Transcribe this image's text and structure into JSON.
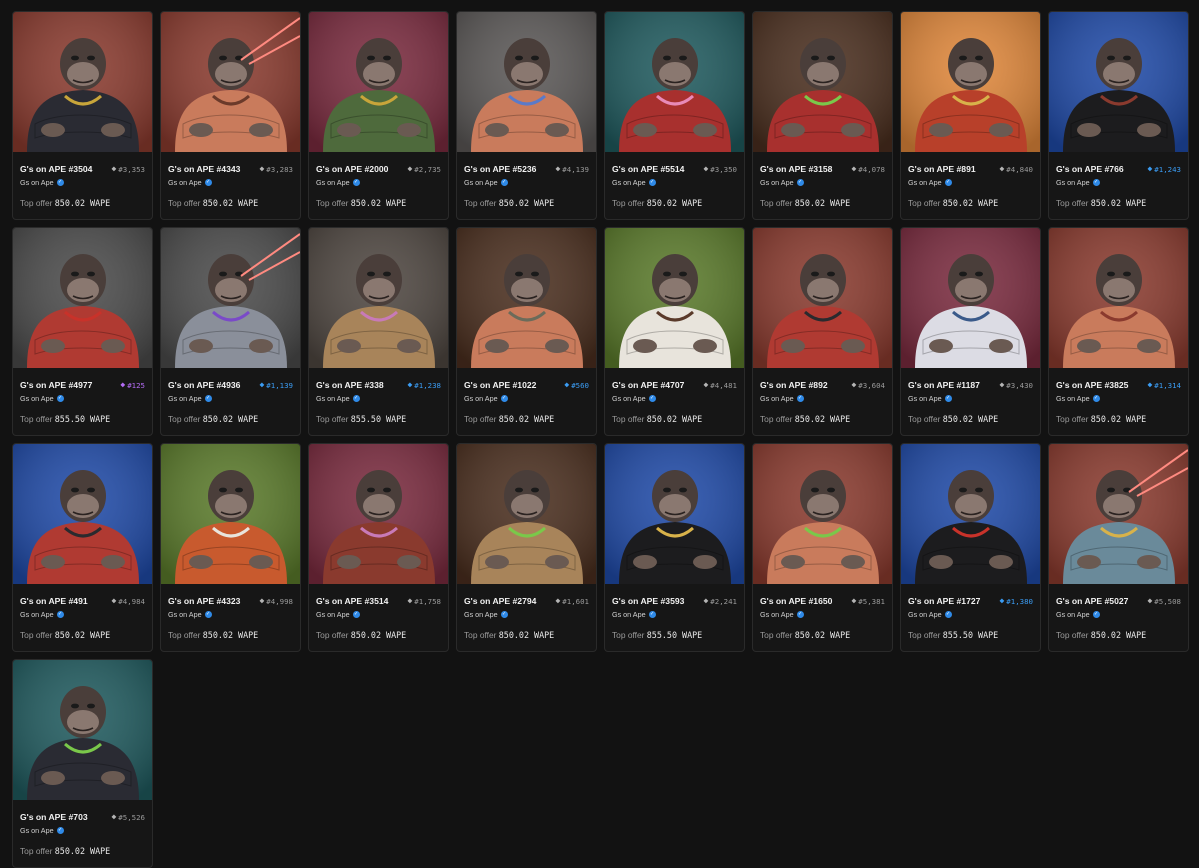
{
  "collection_name": "Gs on Ape",
  "top_offer_label": "Top offer",
  "rank_colors": {
    "gray": "#b5b5b5",
    "blue": "#3b9cf3",
    "purple": "#b46cf4"
  },
  "items": [
    {
      "name": "G's on APE #3504",
      "rank": "#3,353",
      "rank_color": "gray",
      "offer": "850.02 WAPE",
      "bg": "#8a3a2e",
      "body": "#2a2b33",
      "accent": "#c8a53a"
    },
    {
      "name": "G's on APE #4343",
      "rank": "#3,283",
      "rank_color": "gray",
      "offer": "850.02 WAPE",
      "bg": "#8a3a2e",
      "body": "#c97b5c",
      "accent": "#6b3a2a",
      "laser": true
    },
    {
      "name": "G's on APE #2000",
      "rank": "#2,735",
      "rank_color": "gray",
      "offer": "850.02 WAPE",
      "bg": "#7a2a3e",
      "body": "#4e6a3c",
      "accent": "#c8a53a"
    },
    {
      "name": "G's on APE #5236",
      "rank": "#4,139",
      "rank_color": "gray",
      "offer": "850.02 WAPE",
      "bg": "#5a5756",
      "body": "#c97b5c",
      "accent": "#5a7ac8"
    },
    {
      "name": "G's on APE #5514",
      "rank": "#3,350",
      "rank_color": "gray",
      "offer": "850.02 WAPE",
      "bg": "#1f5a5e",
      "body": "#a8302e",
      "accent": "#e88ab8"
    },
    {
      "name": "G's on APE #3158",
      "rank": "#4,078",
      "rank_color": "gray",
      "offer": "850.02 WAPE",
      "bg": "#4a2e1e",
      "body": "#a8302e",
      "accent": "#7ac84a"
    },
    {
      "name": "G's on APE #891",
      "rank": "#4,840",
      "rank_color": "gray",
      "offer": "850.02 WAPE",
      "bg": "#e0873a",
      "body": "#b8402a",
      "accent": "#d8b24a"
    },
    {
      "name": "G's on APE #766",
      "rank": "#1,243",
      "rank_color": "blue",
      "offer": "850.02 WAPE",
      "bg": "#1f4aa8",
      "body": "#1c1c1e",
      "accent": "#8a3a2e"
    },
    {
      "name": "G's on APE #4977",
      "rank": "#125",
      "rank_color": "purple",
      "offer": "855.50 WAPE",
      "bg": "#4a4a4a",
      "body": "#b03a32",
      "accent": "#c8322a"
    },
    {
      "name": "G's on APE #4936",
      "rank": "#1,139",
      "rank_color": "blue",
      "offer": "850.02 WAPE",
      "bg": "#4a4a4a",
      "body": "#8a8f9a",
      "accent": "#7a4ac8",
      "laser": true
    },
    {
      "name": "G's on APE #338",
      "rank": "#1,238",
      "rank_color": "blue",
      "offer": "855.50 WAPE",
      "bg": "#4e4640",
      "body": "#a8845a",
      "accent": "#c87ab8"
    },
    {
      "name": "G's on APE #1022",
      "rank": "#560",
      "rank_color": "blue",
      "offer": "850.02 WAPE",
      "bg": "#4a2e1e",
      "body": "#c97b5c",
      "accent": "#6b6b5a"
    },
    {
      "name": "G's on APE #4707",
      "rank": "#4,481",
      "rank_color": "gray",
      "offer": "850.02 WAPE",
      "bg": "#5a7a2a",
      "body": "#e8e4dc",
      "accent": "#5a3a2a"
    },
    {
      "name": "G's on APE #892",
      "rank": "#3,604",
      "rank_color": "gray",
      "offer": "850.02 WAPE",
      "bg": "#8a3a2e",
      "body": "#b03a32",
      "accent": "#2a2a2e"
    },
    {
      "name": "G's on APE #1187",
      "rank": "#3,430",
      "rank_color": "gray",
      "offer": "850.02 WAPE",
      "bg": "#7a2a3e",
      "body": "#dcdce4",
      "accent": "#3a5a8a"
    },
    {
      "name": "G's on APE #3825",
      "rank": "#1,314",
      "rank_color": "blue",
      "offer": "850.02 WAPE",
      "bg": "#8a3a2e",
      "body": "#c97b5c",
      "accent": "#8a3a2e"
    },
    {
      "name": "G's on APE #491",
      "rank": "#4,984",
      "rank_color": "gray",
      "offer": "850.02 WAPE",
      "bg": "#1f4aa8",
      "body": "#b03a32",
      "accent": "#2a2a2e"
    },
    {
      "name": "G's on APE #4323",
      "rank": "#4,998",
      "rank_color": "gray",
      "offer": "850.02 WAPE",
      "bg": "#5a7a2a",
      "body": "#c85a2e",
      "accent": "#e8e4dc"
    },
    {
      "name": "G's on APE #3514",
      "rank": "#1,758",
      "rank_color": "gray",
      "offer": "850.02 WAPE",
      "bg": "#7a2a3e",
      "body": "#8a3a2e",
      "accent": "#c87ab8"
    },
    {
      "name": "G's on APE #2794",
      "rank": "#1,601",
      "rank_color": "gray",
      "offer": "850.02 WAPE",
      "bg": "#4a2e1e",
      "body": "#a8845a",
      "accent": "#7ac84a"
    },
    {
      "name": "G's on APE #3593",
      "rank": "#2,241",
      "rank_color": "gray",
      "offer": "855.50 WAPE",
      "bg": "#1f4aa8",
      "body": "#1c1c1e",
      "accent": "#d8b24a"
    },
    {
      "name": "G's on APE #1650",
      "rank": "#5,381",
      "rank_color": "gray",
      "offer": "850.02 WAPE",
      "bg": "#8a3a2e",
      "body": "#c97b5c",
      "accent": "#7ac84a"
    },
    {
      "name": "G's on APE #1727",
      "rank": "#1,380",
      "rank_color": "blue",
      "offer": "855.50 WAPE",
      "bg": "#1f4aa8",
      "body": "#1c1c1e",
      "accent": "#c8322a"
    },
    {
      "name": "G's on APE #5027",
      "rank": "#5,508",
      "rank_color": "gray",
      "offer": "850.02 WAPE",
      "bg": "#8a3a2e",
      "body": "#6a8a9a",
      "accent": "#d8b24a",
      "laser": true
    },
    {
      "name": "G's on APE #703",
      "rank": "#5,526",
      "rank_color": "gray",
      "offer": "850.02 WAPE",
      "bg": "#1f5a5e",
      "body": "#2a2b33",
      "accent": "#7ac84a"
    }
  ]
}
